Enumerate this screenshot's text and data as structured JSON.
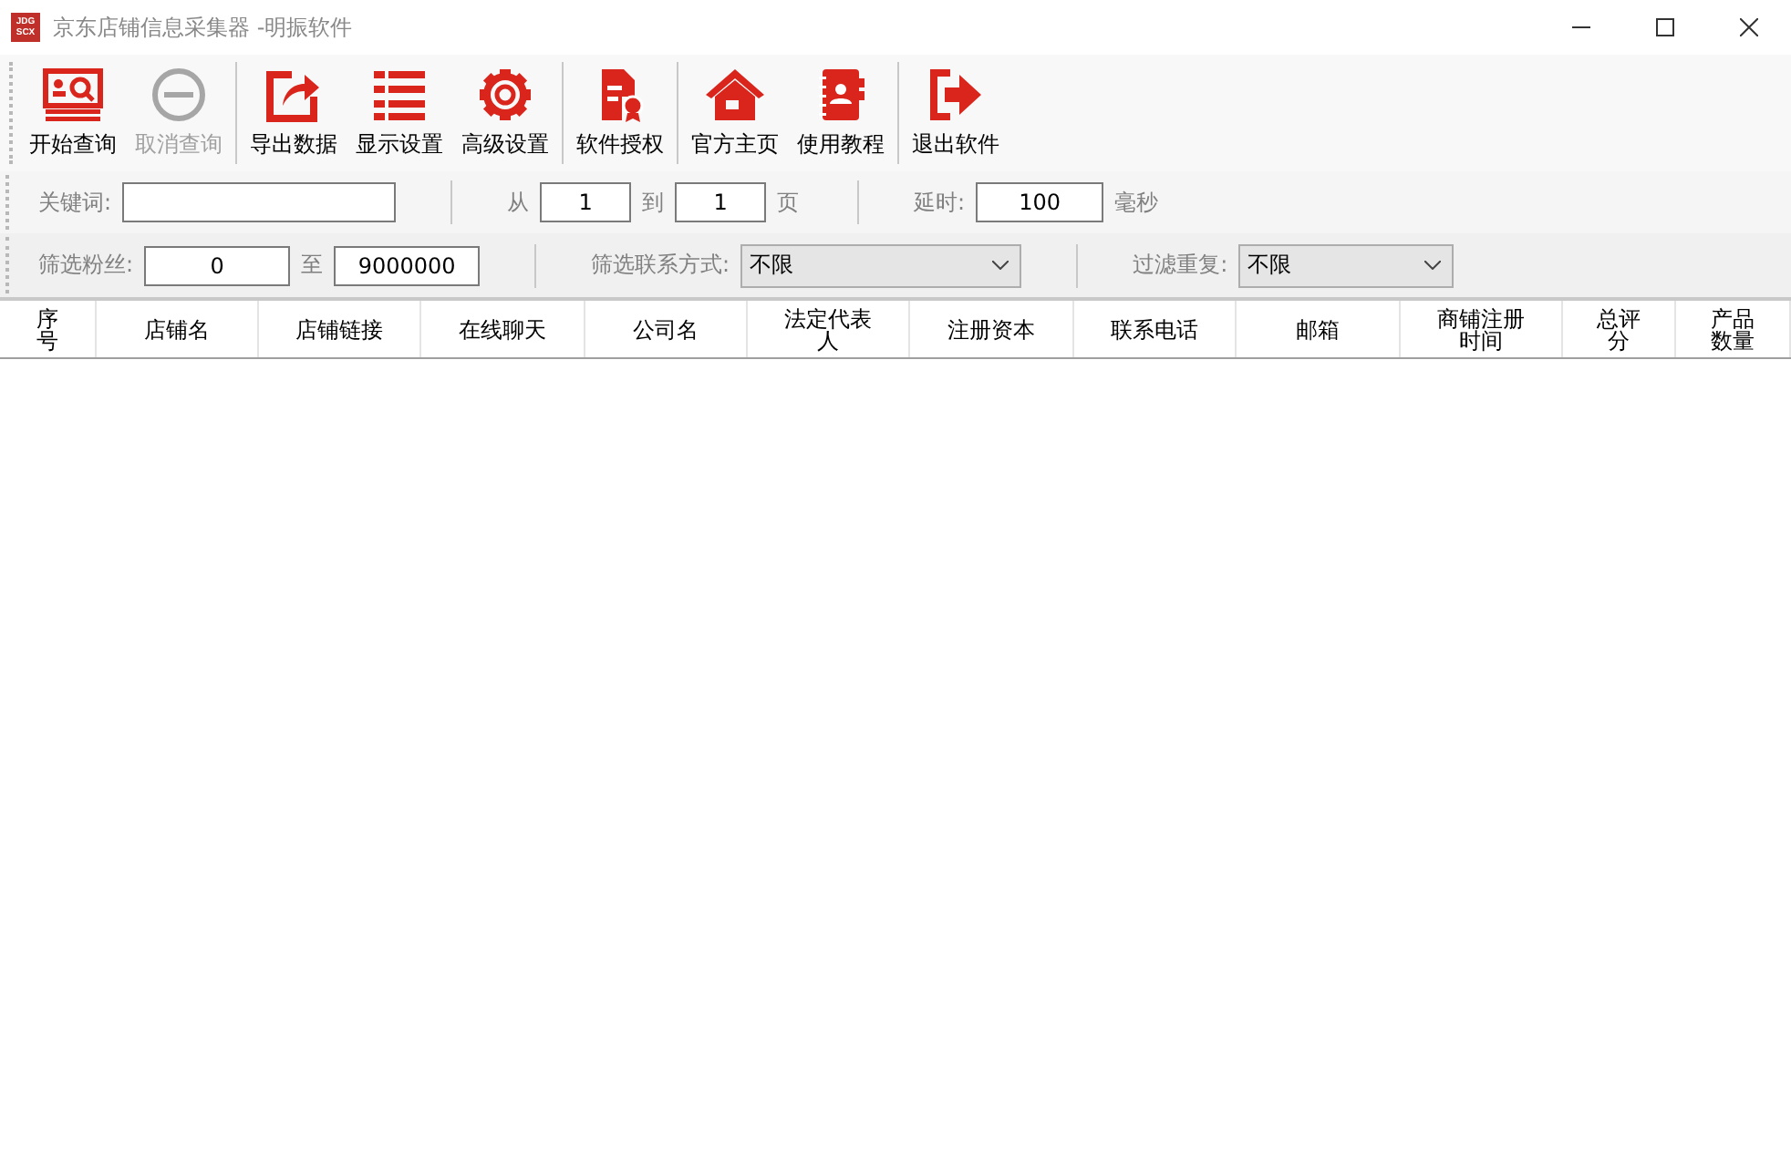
{
  "window": {
    "icon_text": [
      "JDG",
      "SCX"
    ],
    "title": "京东店铺信息采集器 -明振软件"
  },
  "toolbar": [
    {
      "buttons": [
        {
          "kind": "search",
          "label": "开始查询",
          "disabled": false
        },
        {
          "kind": "cancel",
          "label": "取消查询",
          "disabled": true
        }
      ]
    },
    {
      "buttons": [
        {
          "kind": "export",
          "label": "导出数据",
          "disabled": false
        },
        {
          "kind": "list",
          "label": "显示设置",
          "disabled": false
        },
        {
          "kind": "gear",
          "label": "高级设置",
          "disabled": false
        }
      ]
    },
    {
      "buttons": [
        {
          "kind": "license",
          "label": "软件授权",
          "disabled": false
        }
      ]
    },
    {
      "buttons": [
        {
          "kind": "home",
          "label": "官方主页",
          "disabled": false
        },
        {
          "kind": "book",
          "label": "使用教程",
          "disabled": false
        }
      ]
    },
    {
      "buttons": [
        {
          "kind": "exit",
          "label": "退出软件",
          "disabled": false
        }
      ]
    }
  ],
  "search_bar": {
    "keyword_label": "关键词:",
    "from_label": "从",
    "from_value": "1",
    "to_label": "到",
    "to_value": "1",
    "page_label": "页",
    "delay_label": "延时:",
    "delay_value": "100",
    "delay_unit": "毫秒"
  },
  "filter_bar": {
    "fans_label": "筛选粉丝:",
    "fans_min": "0",
    "fans_to_label": "至",
    "fans_max": "9000000",
    "contact_label": "筛选联系方式:",
    "contact_value": "不限",
    "dedupe_label": "过滤重复:",
    "dedupe_value": "不限"
  },
  "table": {
    "columns": [
      "序号",
      "店铺名",
      "店铺链接",
      "在线聊天",
      "公司名",
      "法定代表人",
      "注册资本",
      "联系电话",
      "邮箱",
      "商铺注册时间",
      "总评分",
      "产品数量"
    ]
  }
}
